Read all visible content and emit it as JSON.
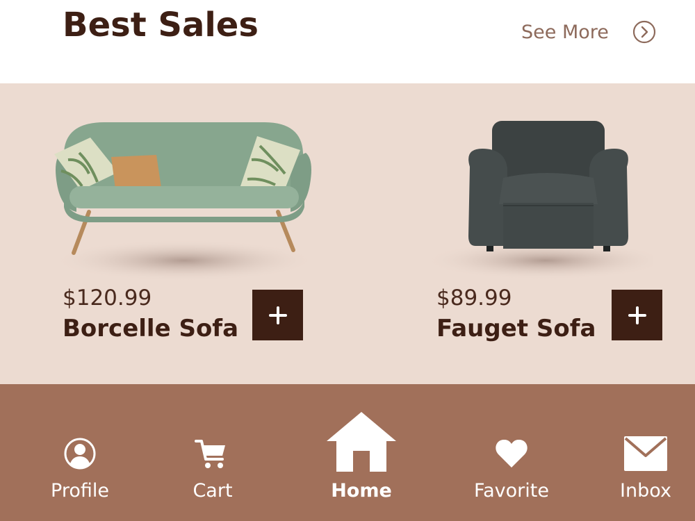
{
  "header": {
    "title": "Best Sales",
    "see_more_label": "See More",
    "see_more_icon": "chevron-right-circle-icon"
  },
  "products": [
    {
      "price": "$120.99",
      "name": "Borcelle Sofa",
      "image": "green-sofa-image",
      "add_icon": "plus-icon"
    },
    {
      "price": "$89.99",
      "name": "Fauget Sofa",
      "image": "dark-gray-armchair-image",
      "add_icon": "plus-icon"
    }
  ],
  "nav": {
    "items": [
      {
        "label": "Profile",
        "icon": "profile-icon"
      },
      {
        "label": "Cart",
        "icon": "cart-icon"
      },
      {
        "label": "Home",
        "icon": "home-icon",
        "active": true
      },
      {
        "label": "Favorite",
        "icon": "heart-icon"
      },
      {
        "label": "Inbox",
        "icon": "mail-icon"
      }
    ]
  },
  "colors": {
    "brand_dark": "#3d1f14",
    "secondary_text": "#8d6a5b",
    "product_bg": "#ecdbd1",
    "nav_bg": "#a1705a",
    "nav_text": "#ffffff"
  }
}
